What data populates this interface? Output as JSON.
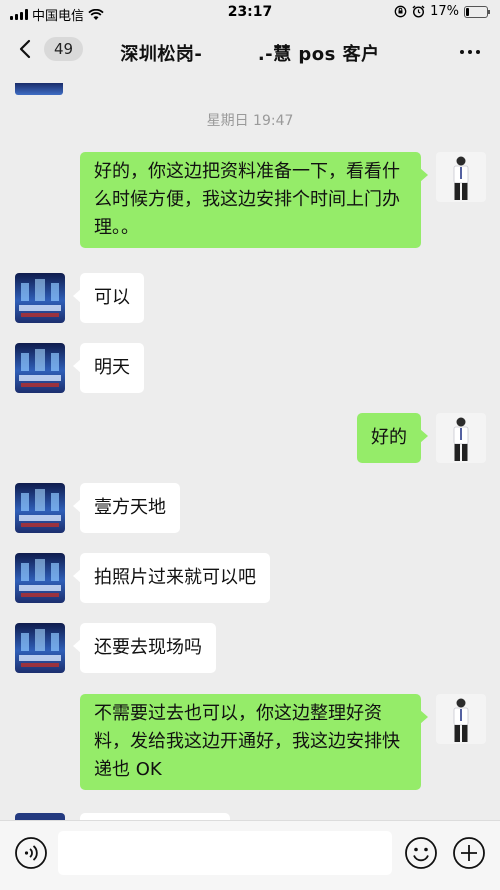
{
  "status_bar": {
    "carrier": "中国电信",
    "time": "23:17",
    "battery_percent": "17%",
    "battery_level": 0.17,
    "icons": [
      "signal-icon",
      "wifi-icon",
      "orientation-lock-icon",
      "alarm-icon",
      "battery-icon"
    ]
  },
  "nav": {
    "back_icon": "chevron-left-icon",
    "unread_count": "49",
    "title": "深圳松岗-　　　.-慧 pos 客户",
    "more_icon": "more-dots-icon"
  },
  "chat": {
    "timestamp": "星期日 19:47",
    "messages": [
      {
        "sender": "me",
        "text": "好的，你这边把资料准备一下，看看什么时候方便，我这边安排个时间上门办理。。"
      },
      {
        "sender": "them",
        "text": "可以"
      },
      {
        "sender": "them",
        "text": "明天"
      },
      {
        "sender": "me",
        "text": "好的"
      },
      {
        "sender": "them",
        "text": "壹方天地"
      },
      {
        "sender": "them",
        "text": "拍照片过来就可以吧"
      },
      {
        "sender": "them",
        "text": "还要去现场吗"
      },
      {
        "sender": "me",
        "text": "不需要过去也可以，你这边整理好资料，发给我这边开通好，我这边安排快递也 OK"
      }
    ]
  },
  "input_bar": {
    "voice_icon": "voice-icon",
    "text_value": "",
    "emoji_icon": "emoji-icon",
    "plus_icon": "plus-icon"
  },
  "colors": {
    "background": "#ededed",
    "my_bubble": "#95ec69",
    "their_bubble": "#ffffff",
    "timestamp": "#9a9a9a"
  }
}
